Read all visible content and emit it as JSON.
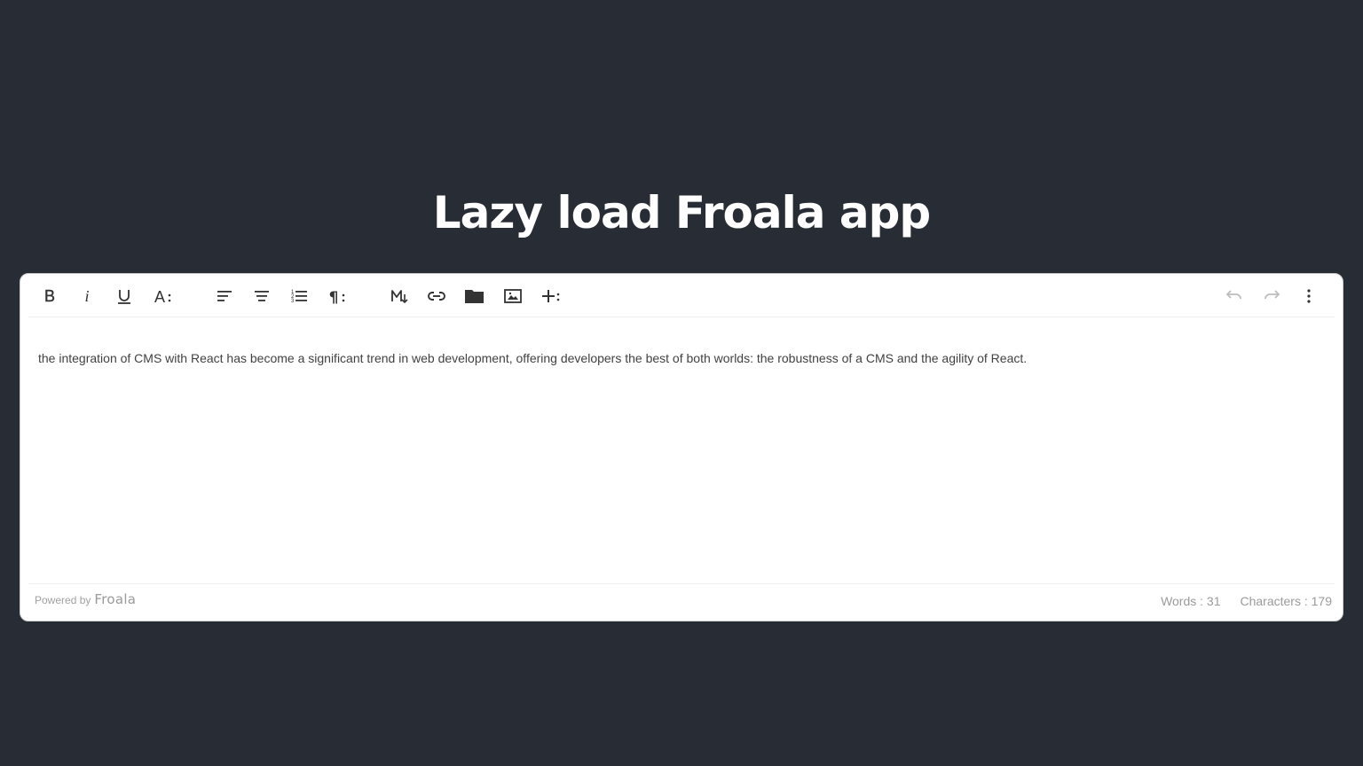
{
  "page": {
    "title": "Lazy load Froala app"
  },
  "toolbar": {
    "left_buttons": [
      {
        "name": "bold",
        "icon": "bold-icon"
      },
      {
        "name": "italic",
        "icon": "italic-icon"
      },
      {
        "name": "underline",
        "icon": "underline-icon"
      },
      {
        "name": "more-text",
        "icon": "text-format-more-icon"
      },
      {
        "name": "align-left",
        "icon": "align-left-icon"
      },
      {
        "name": "align-center",
        "icon": "align-center-icon"
      },
      {
        "name": "ordered-list",
        "icon": "ordered-list-icon"
      },
      {
        "name": "more-paragraph",
        "icon": "paragraph-more-icon"
      },
      {
        "name": "markdown",
        "icon": "markdown-icon"
      },
      {
        "name": "insert-link",
        "icon": "link-icon"
      },
      {
        "name": "insert-file",
        "icon": "folder-icon"
      },
      {
        "name": "insert-image",
        "icon": "image-icon"
      },
      {
        "name": "more-rich",
        "icon": "plus-more-icon"
      }
    ],
    "right_buttons": [
      {
        "name": "undo",
        "icon": "undo-icon",
        "disabled": true
      },
      {
        "name": "redo",
        "icon": "redo-icon",
        "disabled": true
      },
      {
        "name": "more-misc",
        "icon": "kebab-menu-icon"
      }
    ]
  },
  "editor": {
    "content": "the integration of CMS with React has become a significant trend in web development, offering developers the best of both worlds: the robustness of a CMS and the agility of React."
  },
  "footer": {
    "powered_label": "Powered by",
    "powered_brand": "Froala",
    "words_label": "Words : 31",
    "characters_label": "Characters : 179"
  },
  "colors": {
    "background": "#282c34",
    "editor_bg": "#ffffff",
    "icon": "#333333",
    "icon_disabled": "#bdbdbd",
    "muted_text": "#9a9a9a"
  }
}
